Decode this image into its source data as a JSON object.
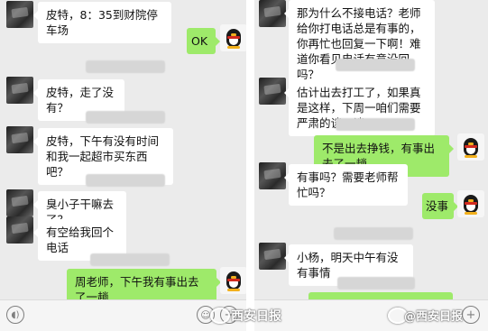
{
  "left_chat": {
    "messages": [
      {
        "text": "皮特，8：35到财院停车场"
      },
      {
        "text": "OK"
      },
      {
        "text": "皮特，走了没有？"
      },
      {
        "text": "皮特，下午有没有时间和我一起超市买东西吧？"
      },
      {
        "text": "臭小子干嘛去了？"
      },
      {
        "text": "有空给我回个电话"
      },
      {
        "text": "周老师，下午我有事出去了一趟"
      }
    ]
  },
  "right_chat": {
    "messages": [
      {
        "text": "那为什么不接电话？老师给你打电话总是有事的，你再忙也回复一下啊！难道你看见电话有意没回吗？"
      },
      {
        "text": "估计出去打工了，如果真是这样，下周一咱们需要严肃的谈一谈"
      },
      {
        "text": "不是出去挣钱，有事出去了一趟"
      },
      {
        "text": "有事吗？需要老师帮忙吗？"
      },
      {
        "text": "没事"
      },
      {
        "text": "小杨，明天中午有没有事情"
      }
    ]
  },
  "watermarks": {
    "left": "西安日报",
    "right": "@西安日报"
  },
  "colors": {
    "chat_background": "#ebebeb",
    "incoming_bubble": "#ffffff",
    "outgoing_bubble": "#9eea6a"
  },
  "icons": {
    "voice": "voice-icon",
    "emoji": "emoji-icon",
    "plus": "plus-icon",
    "contact_avatar": "contact-avatar-icon",
    "self_avatar": "qq-penguin-avatar-icon"
  }
}
